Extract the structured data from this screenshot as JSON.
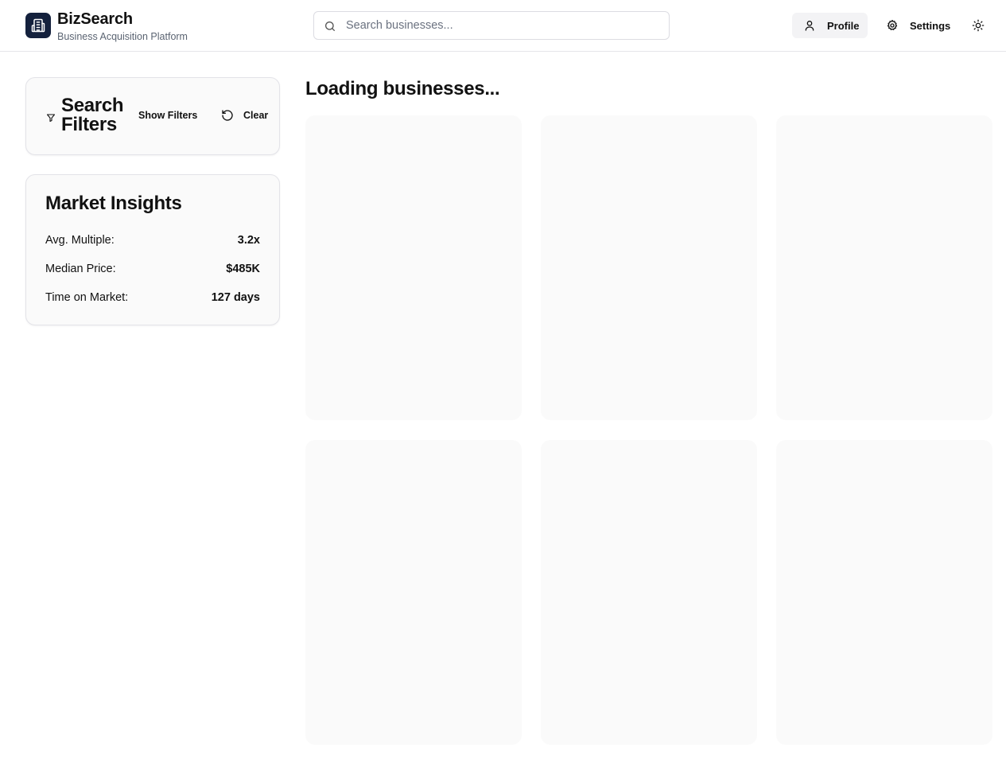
{
  "header": {
    "brand_name": "BizSearch",
    "brand_subtitle": "Business Acquisition Platform",
    "logo_icon": "building-icon",
    "search_placeholder": "Search businesses...",
    "profile_label": "Profile",
    "settings_label": "Settings",
    "theme_icon": "sun-icon"
  },
  "filters": {
    "title": "Search Filters",
    "show_filters_label": "Show Filters",
    "clear_label": "Clear"
  },
  "insights": {
    "title": "Market Insights",
    "rows": [
      {
        "label": "Avg. Multiple:",
        "value": "3.2x"
      },
      {
        "label": "Median Price:",
        "value": "$485K"
      },
      {
        "label": "Time on Market:",
        "value": "127 days"
      }
    ]
  },
  "main": {
    "title": "Loading businesses...",
    "skeleton_count": 6
  },
  "colors": {
    "brand": "#14213d",
    "skeleton": "#fafafa",
    "border": "#e3e3e8"
  }
}
